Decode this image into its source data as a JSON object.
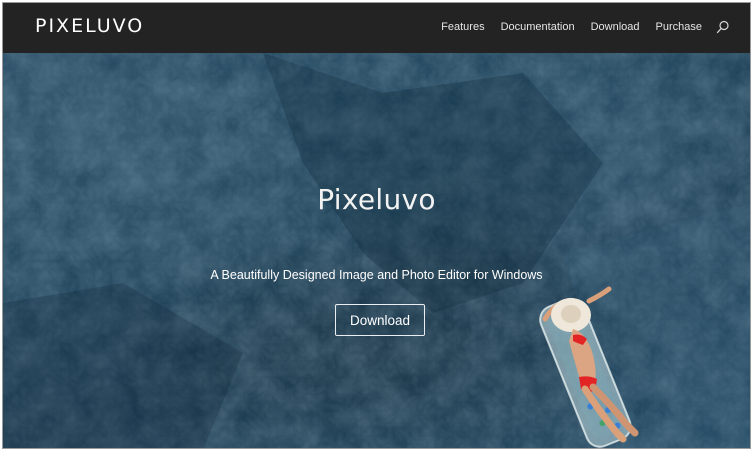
{
  "brand": {
    "logo": "PIXELUVO"
  },
  "nav": {
    "items": [
      {
        "label": "Features"
      },
      {
        "label": "Documentation"
      },
      {
        "label": "Download"
      },
      {
        "label": "Purchase"
      }
    ],
    "search_icon": "search-icon"
  },
  "hero": {
    "title": "Pixeluvo",
    "subtitle": "A Beautifully Designed Image and Photo Editor for Windows",
    "button_label": "Download"
  },
  "colors": {
    "navbar": "#232323",
    "hero_water": "#1d4259",
    "swimsuit": "#e32424"
  }
}
